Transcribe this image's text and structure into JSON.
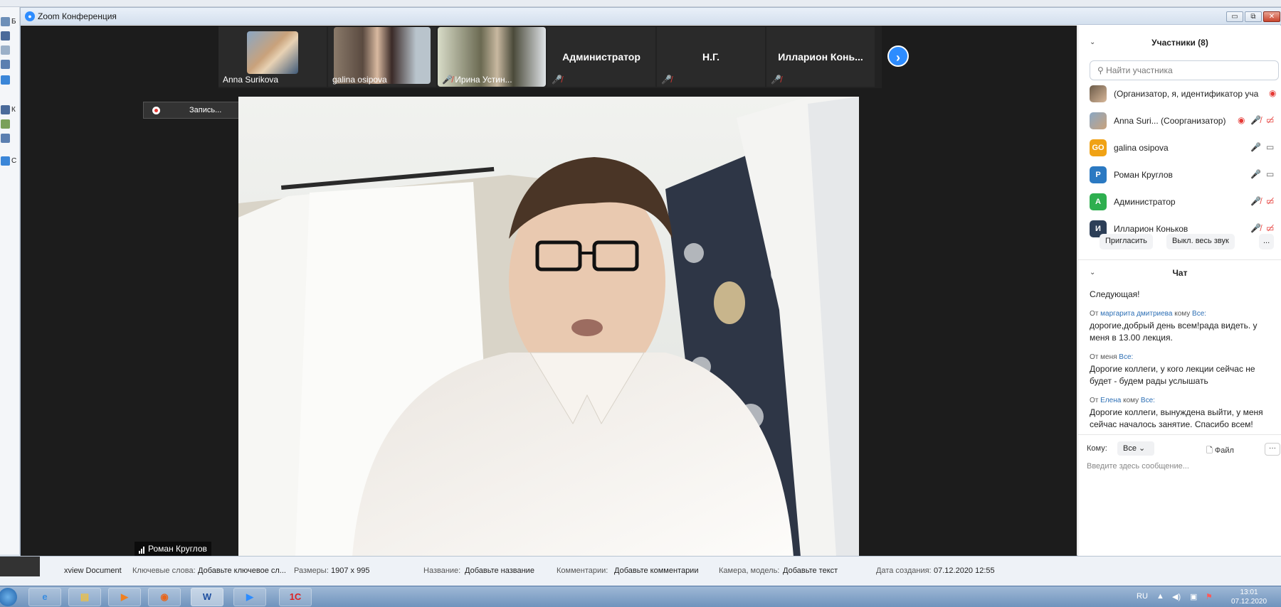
{
  "window": {
    "title": "Zoom Конференция",
    "btn_min": "▭",
    "btn_max": "⧉",
    "btn_close": "✕"
  },
  "desktop_labels": [
    "Б",
    "К",
    "С"
  ],
  "thumbnails": [
    {
      "name": "Anna Surikova",
      "has_video": true
    },
    {
      "name": "galina osipova",
      "has_video": true
    },
    {
      "name": "Ирина Устин...",
      "has_video": true,
      "muted": true
    },
    {
      "name": "Администратор",
      "has_video": false,
      "muted": true
    },
    {
      "name": "Н.Г.",
      "has_video": false,
      "muted": true
    },
    {
      "name": "Илларион  Конь...",
      "has_video": false,
      "muted": true
    }
  ],
  "recording": {
    "label": "Запись..."
  },
  "speaker": {
    "name": "Роман Круглов"
  },
  "participants_panel": {
    "title": "Участники (8)",
    "search_placeholder": "Найти участника",
    "list": [
      {
        "name": "(Организатор, я, идентификатор уча",
        "avatar": "photo",
        "status": "recording-icon"
      },
      {
        "name": "Anna Suri...  (Соорганизатор)",
        "avatar": "photo",
        "status": "muted"
      },
      {
        "name": "galina osipova",
        "avatar": "GO",
        "color": "#f0a215",
        "status": "unmuted"
      },
      {
        "name": "Роман Круглов",
        "avatar": "Р",
        "color": "#2b79c2",
        "status": "unmuted"
      },
      {
        "name": "Администратор",
        "avatar": "А",
        "color": "#2eaf4f",
        "status": "muted"
      },
      {
        "name": "Илларион Коньков",
        "avatar": "И",
        "color": "#2c3e57",
        "status": "muted"
      }
    ],
    "invite": "Пригласить",
    "mute_all": "Выкл. весь звук",
    "more": "..."
  },
  "chat": {
    "title": "Чат",
    "messages": [
      {
        "text": "Следующая!"
      },
      {
        "from_prefix": "От",
        "from": "маргарита дмитриева",
        "to_prefix": "кому",
        "to": "Все:",
        "text": "дорогие,добрый день всем!рада видеть. у меня в 13.00 лекция."
      },
      {
        "from_prefix": "От",
        "from": "меня",
        "to_prefix": "",
        "to": "Все:",
        "text": "Дорогие коллеги, у кого лекции сейчас не будет - будем рады услышать"
      },
      {
        "from_prefix": "От",
        "from": "Елена",
        "to_prefix": "кому",
        "to": "Все:",
        "text": "Дорогие коллеги, вынуждена выйти, у меня сейчас началось занятие. Спасибо всем!"
      }
    ],
    "to_label": "Кому:",
    "to_value": "Все",
    "file": "Файл",
    "more": "···",
    "input_placeholder": "Введите здесь сообщение..."
  },
  "xview_bar": {
    "app": "xview Document",
    "keywords_label": "Ключевые слова:",
    "keywords_value": "Добавьте ключевое сл...",
    "size_label": "Размеры:",
    "size_value": "1907 x 995",
    "name_label": "Название:",
    "name_value": "Добавьте название",
    "comments_label": "Комментарии:",
    "comments_value": "Добавьте комментарии",
    "camera_label": "Камера, модель:",
    "camera_value": "Добавьте текст",
    "created_label": "Дата создания:",
    "created_value": "07.12.2020 12:55"
  },
  "taskbar": {
    "apps": [
      "ie-icon",
      "explorer-icon",
      "media-icon",
      "firefox-icon",
      "word-icon",
      "zoom-icon",
      "1c-icon"
    ],
    "word_label": "W",
    "onec_label": "1С",
    "lang": "RU",
    "time": "13:01",
    "date": "07.12.2020"
  }
}
